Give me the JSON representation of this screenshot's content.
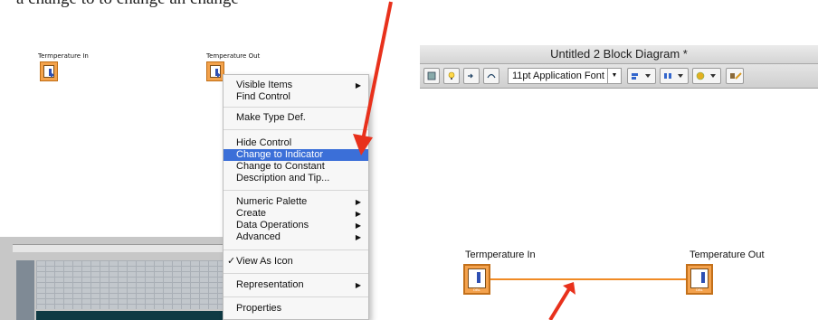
{
  "caption_fragment": "a change to       to change an change",
  "left_panel": {
    "terminal_in_label": "Termperature In",
    "terminal_out_label": "Temperature Out",
    "context_menu": {
      "items": [
        {
          "label": "Visible Items",
          "submenu": true
        },
        {
          "label": "Find Control",
          "submenu": false
        },
        {
          "label": "Make Type Def.",
          "submenu": false
        },
        {
          "label": "Hide Control",
          "submenu": false
        },
        {
          "label": "Change to Indicator",
          "submenu": false,
          "highlighted": true
        },
        {
          "label": "Change to Constant",
          "submenu": false
        },
        {
          "label": "Description and Tip...",
          "submenu": false
        },
        {
          "label": "Numeric Palette",
          "submenu": true
        },
        {
          "label": "Create",
          "submenu": true
        },
        {
          "label": "Data Operations",
          "submenu": true
        },
        {
          "label": "Advanced",
          "submenu": true
        },
        {
          "label": "View As Icon",
          "submenu": false,
          "checked": true
        },
        {
          "label": "Representation",
          "submenu": true
        },
        {
          "label": "Properties",
          "submenu": false
        }
      ]
    }
  },
  "right_panel": {
    "window_title": "Untitled 2 Block Diagram *",
    "font_select_value": "11pt Application Font",
    "terminal_in_label": "Termperature In",
    "terminal_out_label": "Temperature Out",
    "icon_dbl": "DBL"
  },
  "colors": {
    "accent_highlight": "#3b6fd8",
    "annotation_arrow": "#e8311c",
    "wire_orange": "#f08a24",
    "terminal_orange": "#f4a24d"
  }
}
